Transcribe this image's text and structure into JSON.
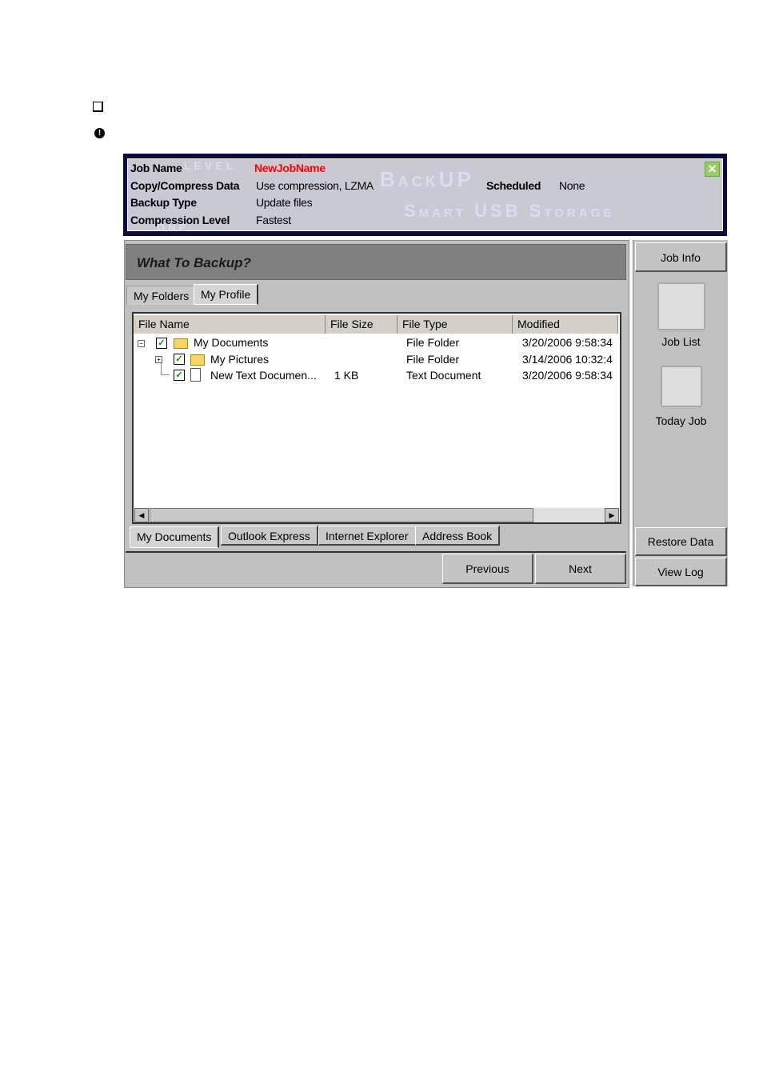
{
  "bullets": [
    {
      "icon": "checkbox-square-icon"
    },
    {
      "icon": "info-circle-icon"
    }
  ],
  "header": {
    "rows": [
      {
        "label": "Job Name",
        "value": "NewJobName"
      },
      {
        "label": "Copy/Compress Data",
        "value": "Use compression, LZMA"
      },
      {
        "label": "Backup Type",
        "value": "Update files"
      },
      {
        "label": "Compression Level",
        "value": "Fastest"
      }
    ],
    "scheduled_label": "Scheduled",
    "scheduled_value": "None",
    "watermark": [
      "level",
      "one",
      "BackUP",
      "Smart USB Storage"
    ],
    "job_name_color": "#ff0000"
  },
  "main": {
    "title": "What To Backup?",
    "tabs": [
      "My Folders",
      "My Profile"
    ],
    "columns": [
      "File Name",
      "File Size",
      "File Type",
      "Modified"
    ],
    "rows": [
      {
        "name": "My Documents",
        "size": "",
        "type": "File Folder",
        "modified": "3/20/2006 9:58:34",
        "checked": true,
        "icon": "folder-open-icon"
      },
      {
        "name": "My Pictures",
        "size": "",
        "type": "File Folder",
        "modified": "3/14/2006 10:32:4",
        "checked": true,
        "icon": "pictures-folder-icon"
      },
      {
        "name": "New Text Documen...",
        "size": "1 KB",
        "type": "Text Document",
        "modified": "3/20/2006 9:58:34",
        "checked": true,
        "icon": "text-document-icon"
      }
    ],
    "bottom_tabs": [
      "My Documents",
      "Outlook Express",
      "Internet Explorer",
      "Address Book"
    ],
    "previous": "Previous",
    "next": "Next"
  },
  "side": {
    "job_info": "Job Info",
    "job_list": "Job List",
    "today_job": "Today Job",
    "restore": "Restore Data",
    "view_log": "View Log"
  }
}
